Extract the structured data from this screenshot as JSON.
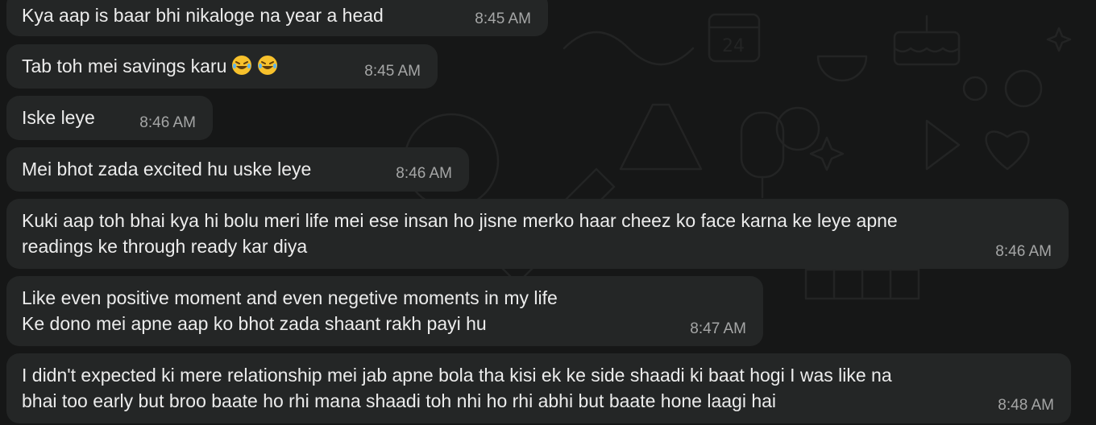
{
  "messages": [
    {
      "text": "Kya aap is baar bhi nikaloge na year a head",
      "time": "8:45 AM"
    },
    {
      "text": "Tab toh mei savings karu",
      "time": "8:45 AM",
      "emoji": [
        "rolling-on-floor-laughing",
        "rolling-on-floor-laughing"
      ]
    },
    {
      "text": "Iske leye",
      "time": "8:46 AM"
    },
    {
      "text": "Mei bhot zada excited hu uske leye",
      "time": "8:46 AM"
    },
    {
      "text": "Kuki aap toh bhai kya hi bolu meri life mei ese insan ho jisne merko haar cheez ko face karna ke leye apne\nreadings ke through ready kar diya",
      "time": "8:46 AM"
    },
    {
      "text": "Like even positive moment and even negetive moments in my life\nKe dono mei apne aap ko bhot zada shaant rakh payi hu",
      "time": "8:47 AM"
    },
    {
      "text": "I didn't expected ki mere relationship mei jab apne bola tha kisi ek ke side shaadi ki baat hogi I was like na\nbhai too early but broo baate ho rhi mana shaadi toh nhi ho rhi abhi but baate hone laagi hai",
      "time": "8:48 AM"
    }
  ],
  "colors": {
    "background": "#161717",
    "bubble_incoming": "#242626",
    "message_text": "#ececec",
    "timestamp_text": "#a5a6a6"
  }
}
